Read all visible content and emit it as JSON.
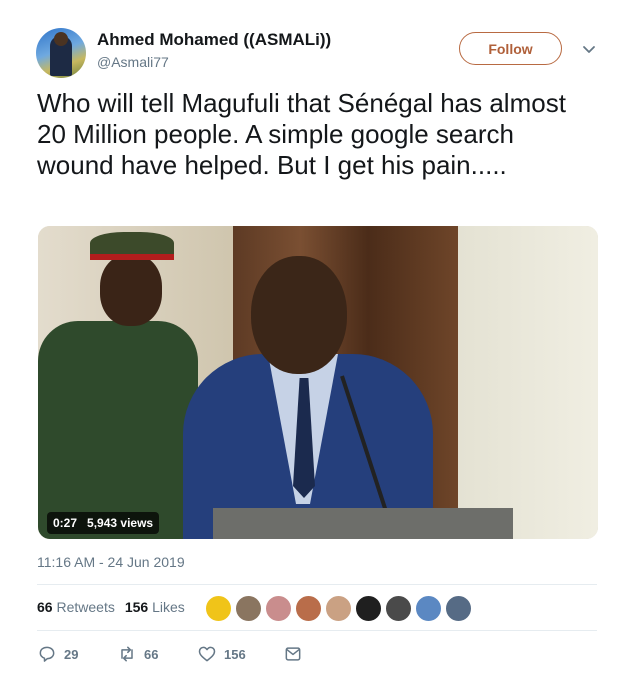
{
  "author": {
    "name": "Ahmed Mohamed ((ASMALi))",
    "handle": "@Asmali77",
    "follow_label": "Follow"
  },
  "tweet": {
    "text": "Who will tell Magufuli that Sénégal has almost 20 Million people. A simple google search wound have helped. But I get his pain.....",
    "timestamp": "11:16 AM - 24 Jun 2019"
  },
  "video": {
    "duration": "0:27",
    "views": "5,943 views"
  },
  "stats": {
    "retweets_count": "66",
    "retweets_label": "Retweets",
    "likes_count": "156",
    "likes_label": "Likes"
  },
  "likers": [
    "#f0c419",
    "#8a7560",
    "#c98d8d",
    "#b96d4a",
    "#caa183",
    "#1f1f1f",
    "#4a4a4a",
    "#5b88c2",
    "#566b85"
  ],
  "actions": {
    "reply_count": "29",
    "retweet_count": "66",
    "like_count": "156"
  },
  "icons": [
    "caret-down-icon",
    "reply-icon",
    "retweet-icon",
    "heart-icon",
    "direct-message-icon"
  ],
  "colors": {
    "follow": "#b0603a",
    "secondary_text": "#657786"
  }
}
